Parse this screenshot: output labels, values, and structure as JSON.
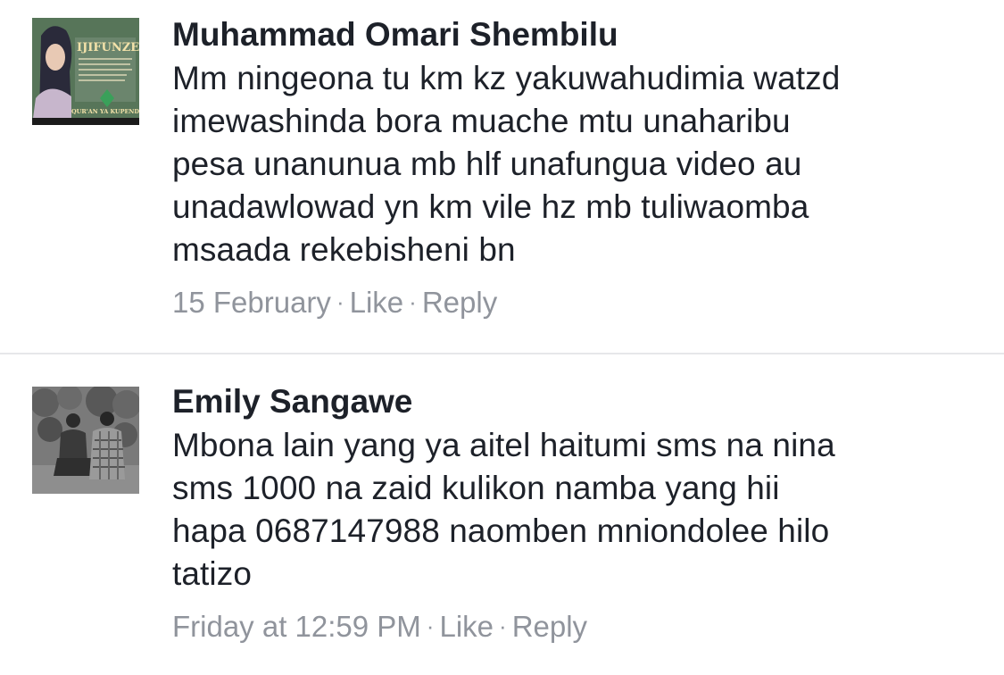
{
  "comments": [
    {
      "author": "Muhammad Omari Shembilu",
      "text": "Mm ningeona tu km kz yakuwahudimia watzd\nimewashinda bora muache mtu unaharibu\npesa unanunua mb hlf unafungua video au\nunadawlowad yn km vile hz mb tuliwaomba\nmsaada rekebisheni bn",
      "timestamp": "15 February",
      "like_label": "Like",
      "reply_label": "Reply",
      "avatar": {
        "title_text": "IJIFUNZE",
        "footer_text": "QUR'AN YA KUPENDEZA",
        "icon": "avatar-illustration"
      }
    },
    {
      "author": "Emily Sangawe",
      "text": "Mbona lain yang ya aitel haitumi sms na nina\nsms 1000 na zaid  kulikon namba yang hii\nhapa 0687147988 naomben mniondolee hilo\ntatizo",
      "timestamp": "Friday at 12:59 PM",
      "like_label": "Like",
      "reply_label": "Reply",
      "avatar": {
        "icon": "avatar-photo"
      }
    }
  ],
  "separator": "·",
  "colors": {
    "text": "#1d2129",
    "meta": "#90949c",
    "divider": "#e6e7ea"
  }
}
